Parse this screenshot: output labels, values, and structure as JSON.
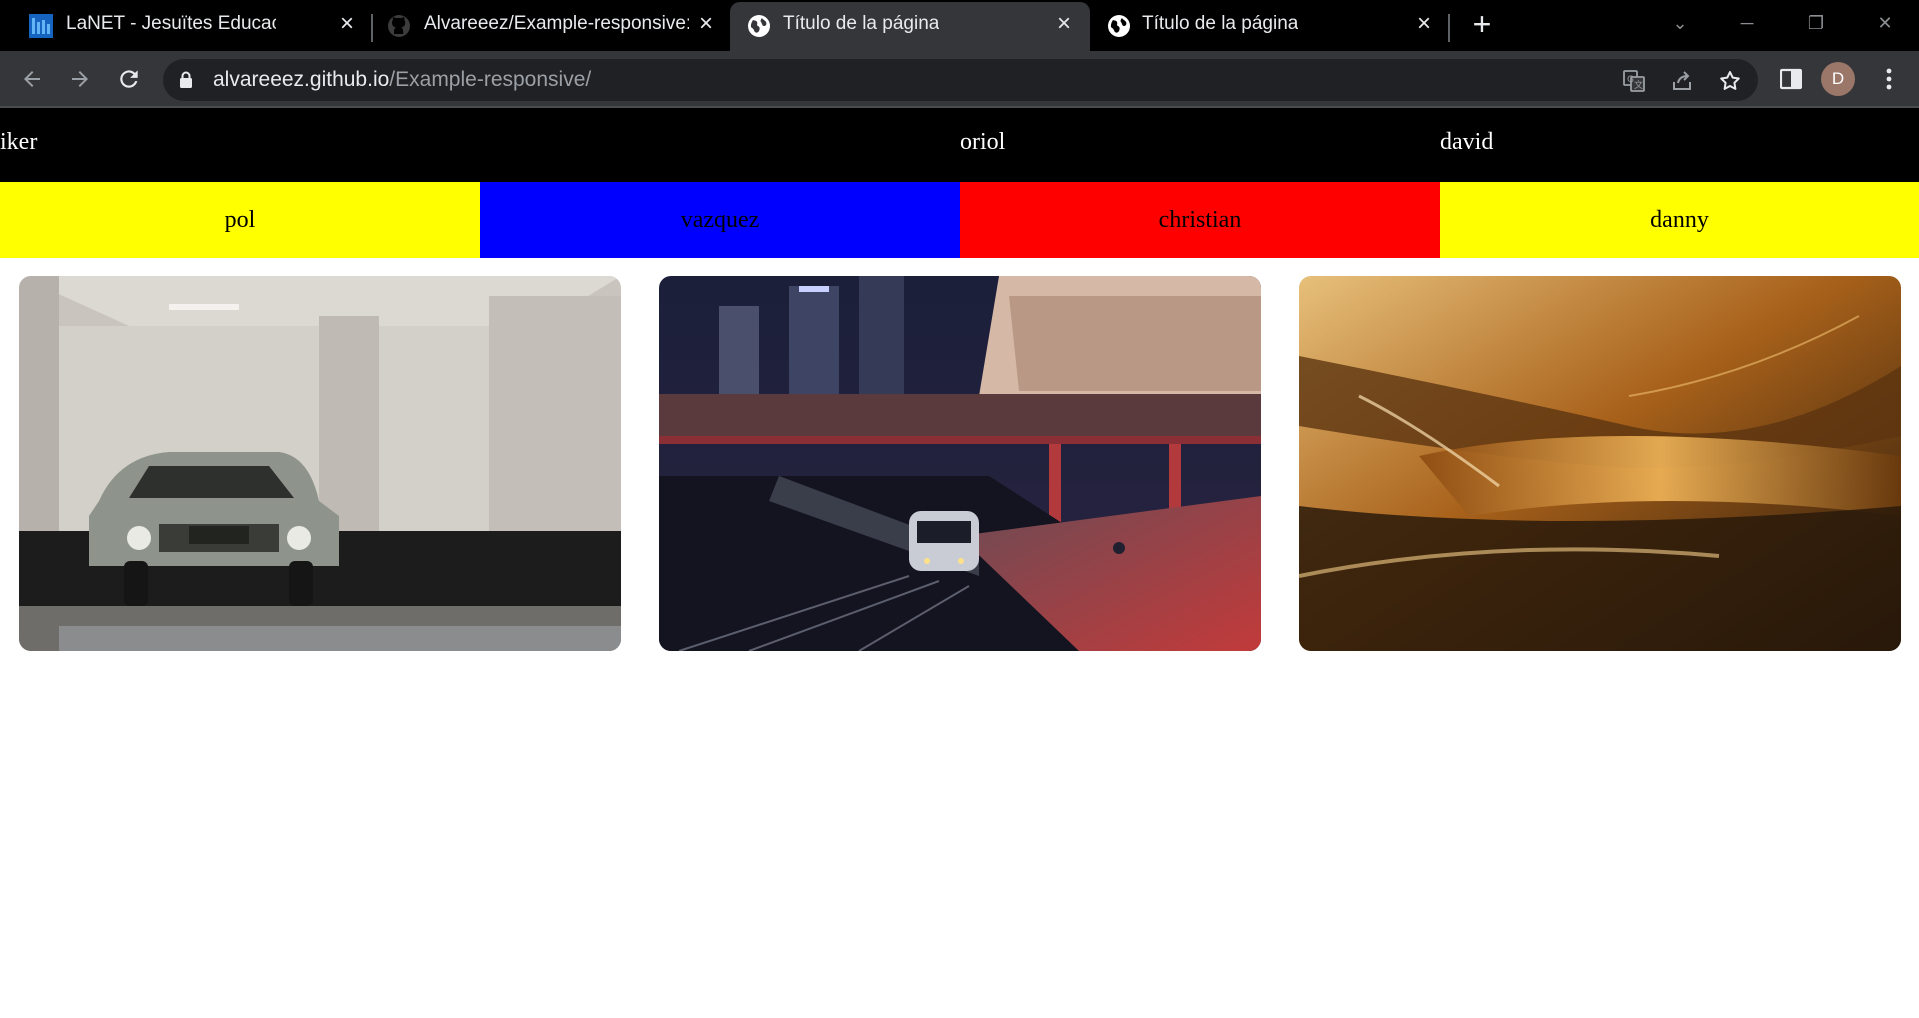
{
  "browser": {
    "tabs": [
      {
        "title": "LaNET - Jesuïtes Educació",
        "icon": "lanet-favicon-icon",
        "active": false
      },
      {
        "title": "Alvareeez/Example-responsive: Ej",
        "icon": "github-icon",
        "active": false
      },
      {
        "title": "Título de la página",
        "icon": "globe-icon",
        "active": true
      },
      {
        "title": "Título de la página",
        "icon": "globe-icon",
        "active": false
      }
    ],
    "new_tab": "+",
    "url_host": "alvareeez.github.io",
    "url_path": "/Example-responsive/",
    "profile_initial": "D"
  },
  "page": {
    "top_nav": [
      "iker",
      "oriol",
      "david"
    ],
    "color_nav": [
      {
        "label": "pol",
        "color": "#ffff00"
      },
      {
        "label": "vazquez",
        "color": "#0000ff"
      },
      {
        "label": "christian",
        "color": "#ff0000"
      },
      {
        "label": "danny",
        "color": "#ffff00"
      }
    ],
    "gallery": [
      {
        "subject": "vintage car parked in garage"
      },
      {
        "subject": "night train at station platform"
      },
      {
        "subject": "abstract golden motion blur"
      }
    ]
  }
}
